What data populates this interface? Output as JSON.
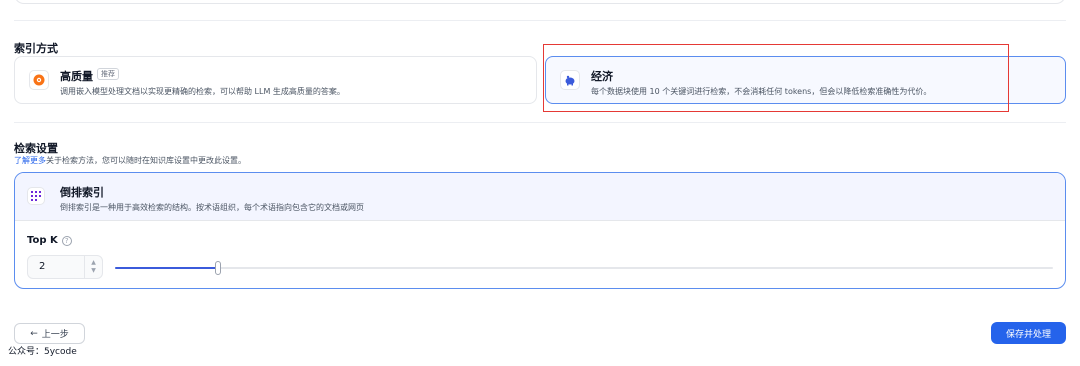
{
  "index_method": {
    "section_title": "索引方式",
    "options": [
      {
        "title": "高质量",
        "badge": "推荐",
        "description": "调用嵌入模型处理文档以实现更精确的检索，可以帮助 LLM 生成高质量的答案。",
        "icon": "orange-gear-icon"
      },
      {
        "title": "经济",
        "description": "每个数据块使用 10 个关键词进行检索，不会消耗任何 tokens，但会以降低检索准确性为代价。",
        "icon": "piggy-bank-icon",
        "selected": true
      }
    ]
  },
  "retrieval_settings": {
    "section_title": "检索设置",
    "learn_more": "了解更多",
    "description": "关于检索方法，您可以随时在知识库设置中更改此设置。",
    "method": {
      "title": "倒排索引",
      "description": "倒排索引是一种用于高效检索的结构。按术语组织，每个术语指向包含它的文档或网页",
      "icon": "grid-dots-icon"
    },
    "top_k": {
      "label": "Top K",
      "value": "2",
      "help_icon": "question-circle-icon",
      "slider_fraction": 0.11
    }
  },
  "footer": {
    "prev_label": "上一步",
    "prev_icon": "arrow-left-icon",
    "save_label": "保存并处理",
    "watermark": "公众号：5ycode"
  },
  "colors": {
    "accent": "#2563eb",
    "selected_border": "#5b8def",
    "highlight_box": "#e53935"
  }
}
